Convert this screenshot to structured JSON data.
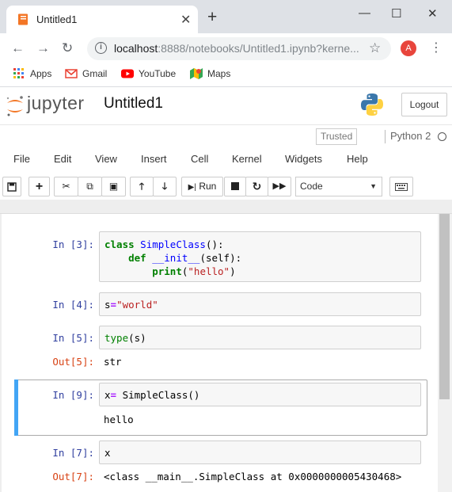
{
  "browser": {
    "tab_title": "Untitled1",
    "tab_close": "✕",
    "new_tab": "+",
    "window_controls": {
      "minimize": "—",
      "maximize": "☐",
      "close": "✕"
    },
    "nav": {
      "back": "←",
      "forward": "→",
      "reload": "↻"
    },
    "url_host": "localhost",
    "url_rest": ":8888/notebooks/Untitled1.ipynb?kerne...",
    "profile_initial": "A",
    "bookmarks": [
      {
        "label": "Apps",
        "icon": "apps-grid-icon"
      },
      {
        "label": "Gmail",
        "icon": "gmail-icon"
      },
      {
        "label": "YouTube",
        "icon": "youtube-icon"
      },
      {
        "label": "Maps",
        "icon": "maps-icon"
      }
    ]
  },
  "jupyter": {
    "logo_text": "jupyter",
    "notebook_name": "Untitled1",
    "logout_label": "Logout",
    "trusted_label": "Trusted",
    "kernel_name": "Python 2",
    "menu": [
      "File",
      "Edit",
      "View",
      "Insert",
      "Cell",
      "Kernel",
      "Widgets",
      "Help"
    ],
    "toolbar": {
      "run_label": "Run",
      "cell_type": "Code"
    }
  },
  "cells": [
    {
      "prompt": "In [3]:",
      "code": [
        "class SimpleClass():",
        "    def __init__(self):",
        "        print(\"hello\")"
      ]
    },
    {
      "prompt": "In [4]:",
      "code": [
        "s=\"world\""
      ]
    },
    {
      "prompt": "In [5]:",
      "code": [
        "type(s)"
      ],
      "out_prompt": "Out[5]:",
      "output": "str"
    },
    {
      "prompt": "In [9]:",
      "code": [
        "x= SimpleClass()"
      ],
      "output": "hello",
      "selected": true
    },
    {
      "prompt": "In [7]:",
      "code": [
        "x"
      ],
      "out_prompt": "Out[7]:",
      "output": "<class __main__.SimpleClass at 0x0000000005430468>"
    }
  ],
  "colors": {
    "in_prompt": "#303f9f",
    "out_prompt": "#d84315",
    "selected_bar": "#42a5f5",
    "keyword": "#008000",
    "string": "#ba2121"
  }
}
